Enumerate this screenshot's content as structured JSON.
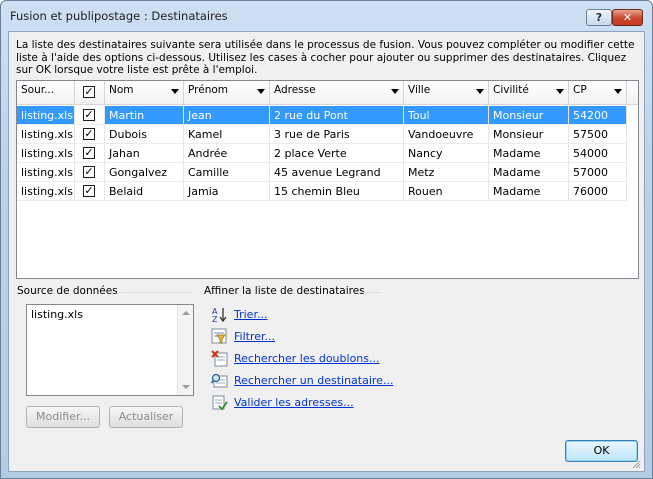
{
  "window": {
    "title": "Fusion et publipostage : Destinataires",
    "help_label": "?",
    "close_label": "✕"
  },
  "intro_text": "La liste des destinataires suivante sera utilisée dans le processus de fusion. Vous pouvez compléter ou modifier cette liste à l'aide des options ci-dessous. Utilisez les cases à cocher pour ajouter ou supprimer des destinataires. Cliquez sur OK lorsque votre liste est prête à l'emploi.",
  "table": {
    "columns": [
      "Sour...",
      "",
      "Nom",
      "Prénom",
      "Adresse",
      "Ville",
      "Civilité",
      "CP"
    ],
    "rows": [
      {
        "source": "listing.xls",
        "checked": true,
        "nom": "Martin",
        "prenom": "Jean",
        "adresse": "2 rue du Pont",
        "ville": "Toul",
        "civilite": "Monsieur",
        "cp": "54200",
        "selected": true
      },
      {
        "source": "listing.xls",
        "checked": true,
        "nom": "Dubois",
        "prenom": "Kamel",
        "adresse": "3 rue de Paris",
        "ville": "Vandoeuvre",
        "civilite": "Monsieur",
        "cp": "57500",
        "selected": false
      },
      {
        "source": "listing.xls",
        "checked": true,
        "nom": "Jahan",
        "prenom": "Andrée",
        "adresse": "2 place Verte",
        "ville": "Nancy",
        "civilite": "Madame",
        "cp": "54000",
        "selected": false
      },
      {
        "source": "listing.xls",
        "checked": true,
        "nom": "Gongalvez",
        "prenom": "Camille",
        "adresse": "45 avenue Legrand",
        "ville": "Metz",
        "civilite": "Madame",
        "cp": "57000",
        "selected": false
      },
      {
        "source": "listing.xls",
        "checked": true,
        "nom": "Belaid",
        "prenom": "Jamia",
        "adresse": "15 chemin Bleu",
        "ville": "Rouen",
        "civilite": "Madame",
        "cp": "76000",
        "selected": false
      }
    ]
  },
  "data_source": {
    "label": "Source de données",
    "items": [
      "listing.xls"
    ],
    "modify_label": "Modifier...",
    "refresh_label": "Actualiser"
  },
  "refine": {
    "label": "Affiner la liste de destinataires",
    "actions": [
      {
        "label": "Trier...",
        "icon": "sort-az-icon"
      },
      {
        "label": "Filtrer...",
        "icon": "filter-icon"
      },
      {
        "label": "Rechercher les doublons...",
        "icon": "duplicates-icon"
      },
      {
        "label": "Rechercher un destinataire...",
        "icon": "find-recipient-icon"
      },
      {
        "label": "Valider les adresses...",
        "icon": "validate-addresses-icon"
      }
    ]
  },
  "ok_label": "OK",
  "colors": {
    "selection": "#3399ff",
    "link": "#0033cc"
  }
}
